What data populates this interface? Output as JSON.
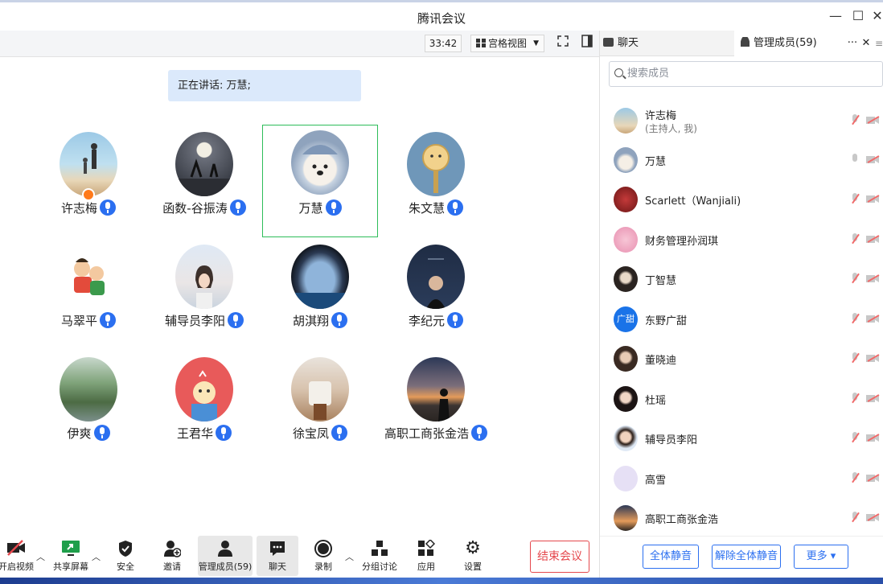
{
  "window": {
    "title": "腾讯会议",
    "minimize": "—",
    "maximize": "☐",
    "close": "✕"
  },
  "toolbar": {
    "timer": "33:42",
    "view_label": "宫格视图",
    "view_caret": "▼"
  },
  "speaking": {
    "text": "正在讲话: 万慧;"
  },
  "participants": [
    {
      "name": "许志梅",
      "host": true
    },
    {
      "name": "函数-谷振涛"
    },
    {
      "name": "万慧",
      "active": true
    },
    {
      "name": "朱文慧"
    },
    {
      "name": "马翠平"
    },
    {
      "name": "辅导员李阳"
    },
    {
      "name": "胡淇翔"
    },
    {
      "name": "李纪元"
    },
    {
      "name": "伊爽"
    },
    {
      "name": "王君华"
    },
    {
      "name": "徐宝凤"
    },
    {
      "name": "高职工商张金浩"
    }
  ],
  "bottombar": {
    "video": "开启视频",
    "share": "共享屏幕",
    "security": "安全",
    "invite": "邀请",
    "members": "管理成员(59)",
    "chat": "聊天",
    "record": "录制",
    "breakout": "分组讨论",
    "apps": "应用",
    "settings": "设置",
    "end": "结束会议"
  },
  "panel": {
    "tab_chat": "聊天",
    "tab_members": "管理成员(59)",
    "more": "···",
    "close": "✕",
    "search_placeholder": "搜索成员",
    "members": [
      {
        "name": "许志梅",
        "sub": "(主持人, 我)",
        "mic": "off"
      },
      {
        "name": "万慧",
        "mic": "on"
      },
      {
        "name": "Scarlett（Wanjiali)",
        "mic": "off"
      },
      {
        "name": "财务管理孙润琪",
        "mic": "off"
      },
      {
        "name": "丁智慧",
        "mic": "off"
      },
      {
        "name": "东野广甜",
        "avatar_text": "广甜",
        "mic": "off"
      },
      {
        "name": "董晓迪",
        "mic": "off"
      },
      {
        "name": "杜瑶",
        "mic": "off"
      },
      {
        "name": "辅导员李阳",
        "mic": "off"
      },
      {
        "name": "高雪",
        "mic": "off"
      },
      {
        "name": "高职工商张金浩",
        "mic": "off"
      }
    ],
    "mute_all": "全体静音",
    "unmute_all": "解除全体静音",
    "more_btn": "更多 ▾"
  }
}
